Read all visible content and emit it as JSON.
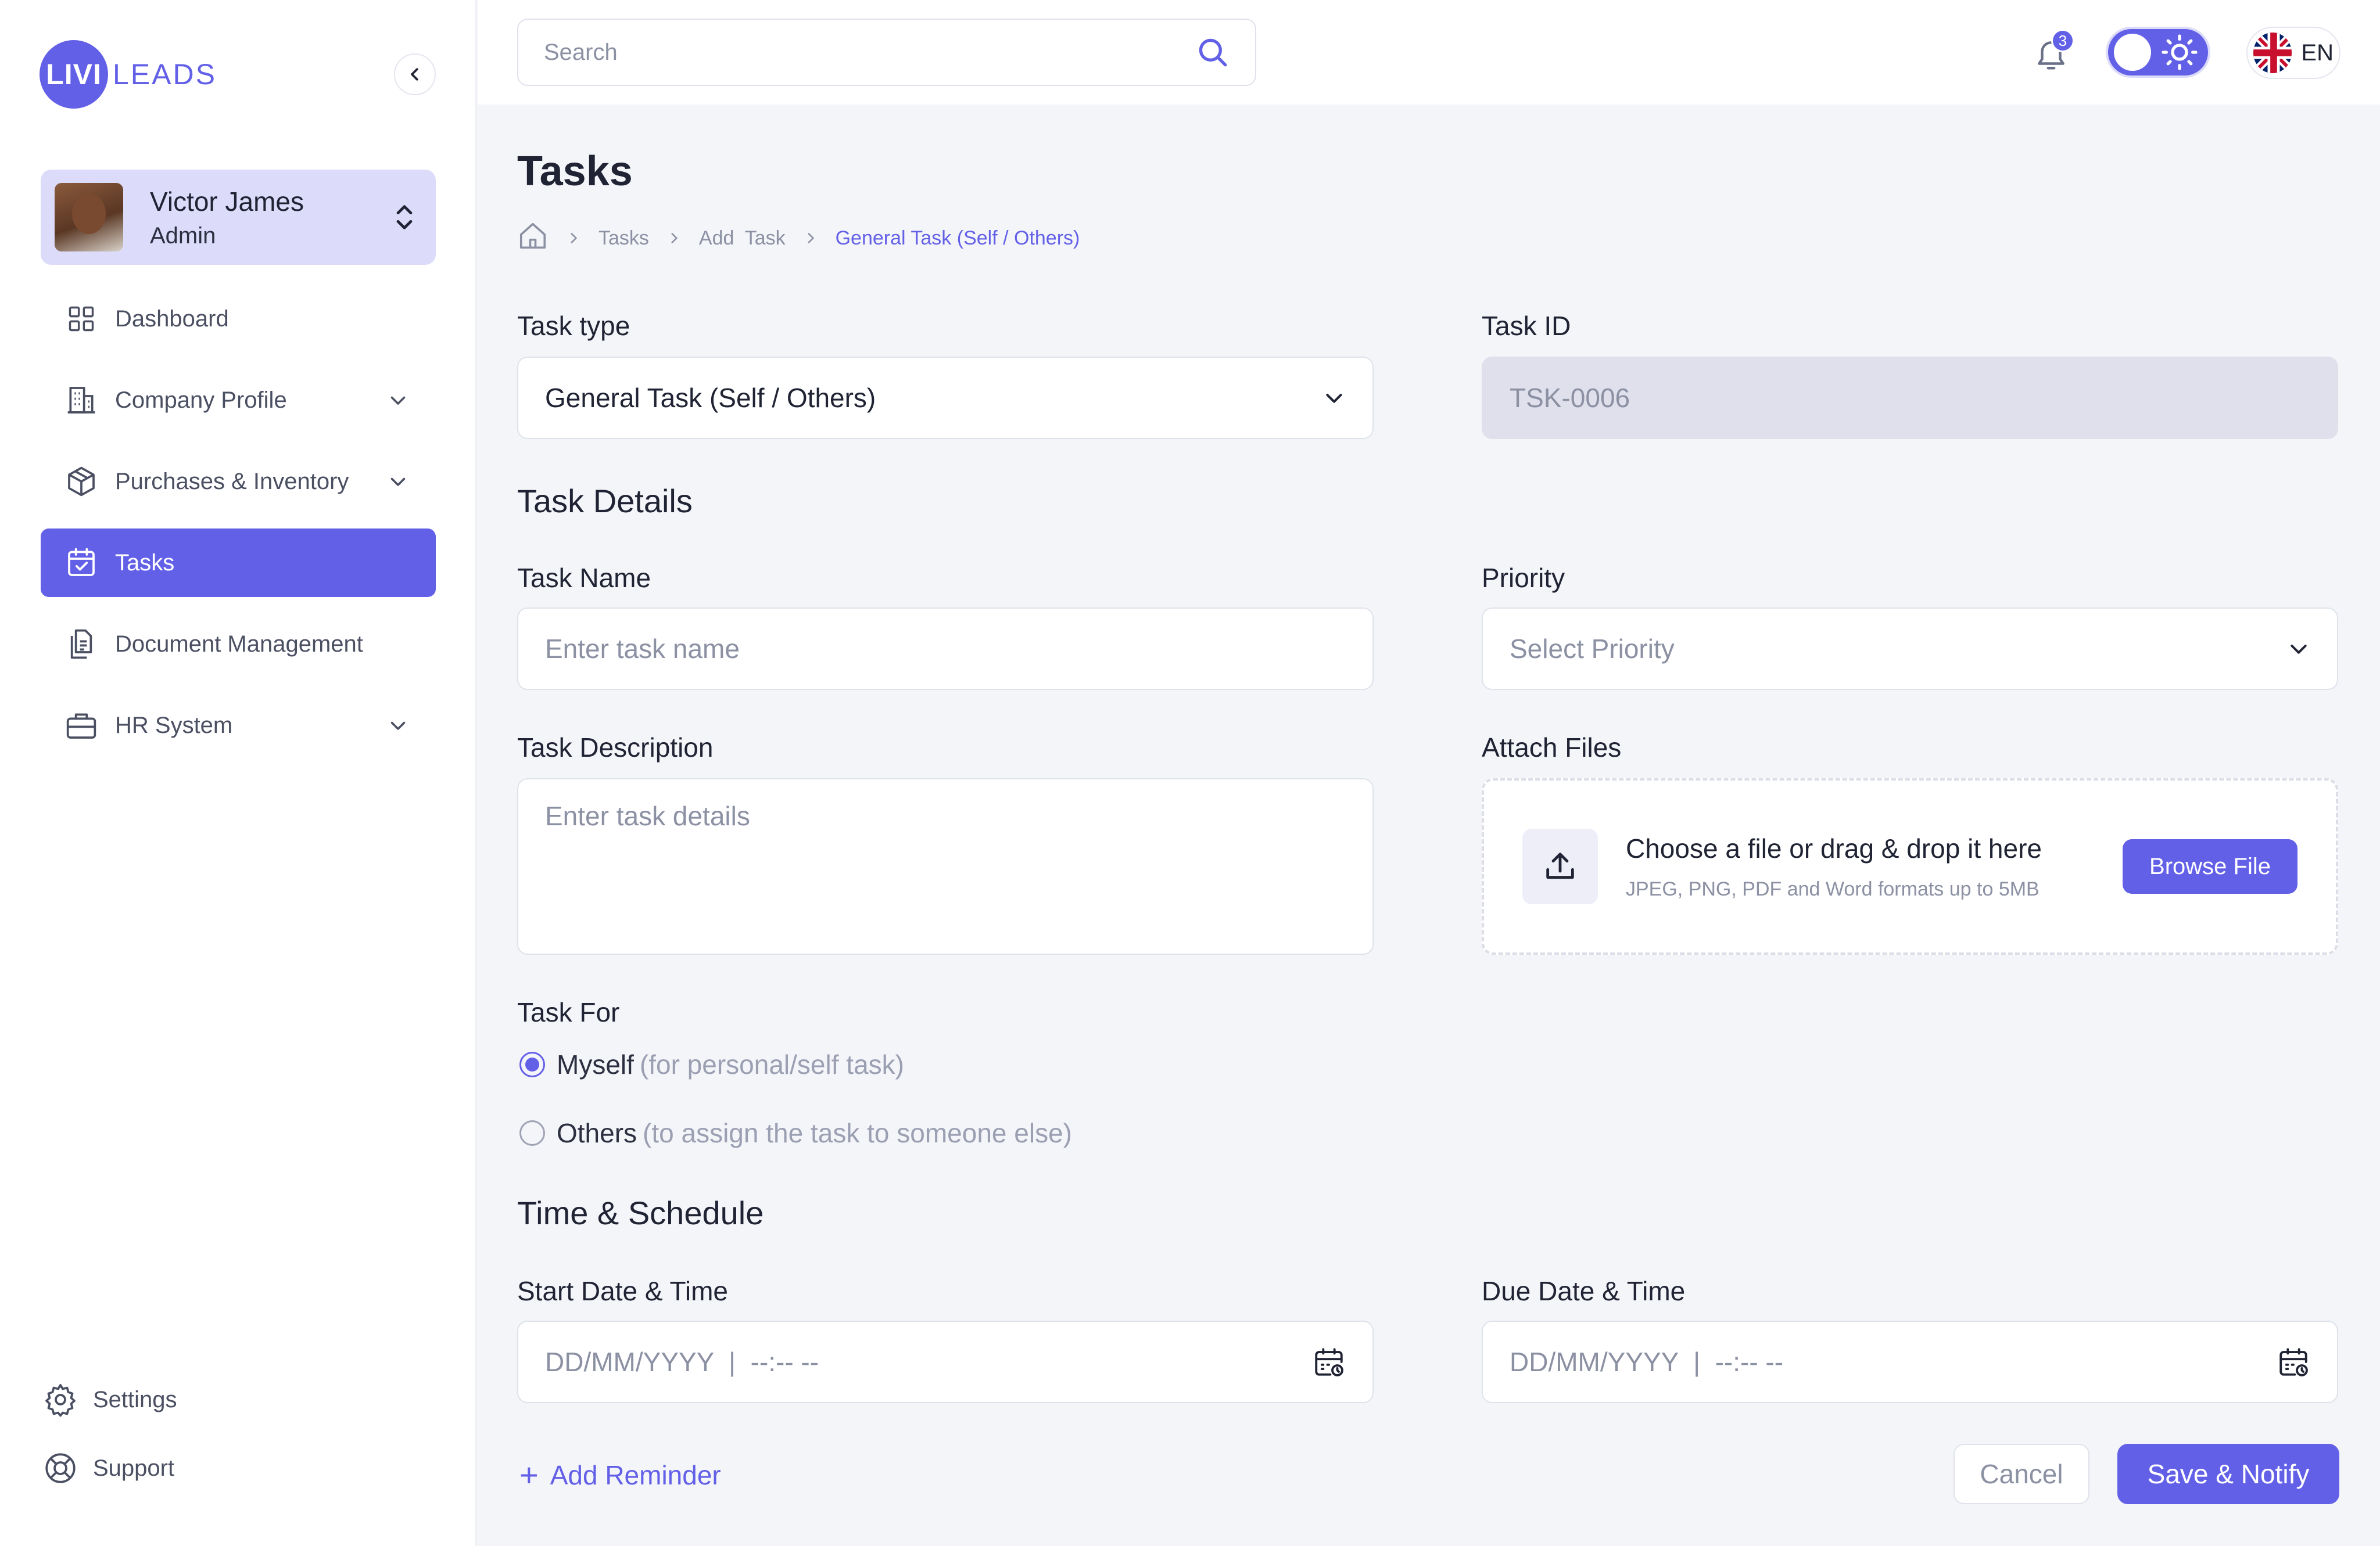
{
  "brand": {
    "badge": "LIVI",
    "text": "LEADS",
    "accent": "#6360e8"
  },
  "user": {
    "name": "Victor James",
    "role": "Admin"
  },
  "sidebar": {
    "items": [
      {
        "label": "Dashboard",
        "icon": "grid-icon",
        "active": false,
        "expandable": false
      },
      {
        "label": "Company Profile",
        "icon": "building-icon",
        "active": false,
        "expandable": true
      },
      {
        "label": "Purchases & Inventory",
        "icon": "box-icon",
        "active": false,
        "expandable": true
      },
      {
        "label": "Tasks",
        "icon": "calendar-check-icon",
        "active": true,
        "expandable": false
      },
      {
        "label": "Document Management",
        "icon": "document-icon",
        "active": false,
        "expandable": false
      },
      {
        "label": "HR System",
        "icon": "briefcase-icon",
        "active": false,
        "expandable": true
      }
    ],
    "bottom": [
      {
        "label": "Settings",
        "icon": "gear-icon"
      },
      {
        "label": "Support",
        "icon": "lifebuoy-icon"
      }
    ]
  },
  "topbar": {
    "search_placeholder": "Search",
    "notification_count": "3",
    "language": "EN"
  },
  "page": {
    "title": "Tasks",
    "breadcrumb": [
      "Tasks",
      "Add  Task",
      "General Task (Self / Others)"
    ]
  },
  "form": {
    "task_type_label": "Task type",
    "task_type_value": "General Task (Self / Others)",
    "task_id_label": "Task ID",
    "task_id_value": "TSK-0006",
    "details_heading": "Task Details",
    "task_name_label": "Task Name",
    "task_name_placeholder": "Enter task name",
    "priority_label": "Priority",
    "priority_placeholder": "Select Priority",
    "description_label": "Task Description",
    "description_placeholder": "Enter task details",
    "attach_label": "Attach Files",
    "dropzone_title": "Choose a file or drag & drop it here",
    "dropzone_sub": "JPEG, PNG, PDF and Word formats up to 5MB",
    "browse_label": "Browse File",
    "task_for_label": "Task For",
    "task_for_options": [
      {
        "label": "Myself",
        "hint": "(for personal/self task)",
        "checked": true
      },
      {
        "label": "Others",
        "hint": "(to assign the task to someone else)",
        "checked": false
      }
    ],
    "schedule_heading": "Time & Schedule",
    "start_label": "Start Date & Time",
    "start_placeholder": "DD/MM/YYYY  |  --:-- --",
    "due_label": "Due Date & Time",
    "due_placeholder": "DD/MM/YYYY  |  --:-- --",
    "add_reminder": "Add Reminder",
    "cancel_label": "Cancel",
    "save_label": "Save & Notify"
  }
}
